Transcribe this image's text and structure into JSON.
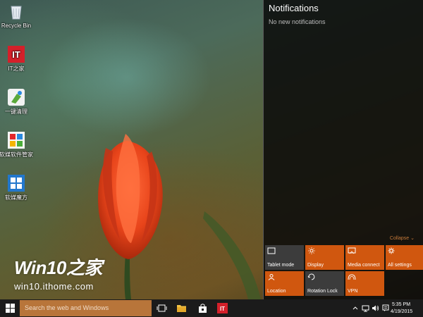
{
  "desktop": {
    "icons": [
      {
        "label": "Recycle Bin"
      },
      {
        "label": "IT之家"
      },
      {
        "label": "一键清理"
      },
      {
        "label": "软媒软件管家"
      },
      {
        "label": "软媒魔方"
      }
    ],
    "watermark": {
      "title": "Win10之家",
      "url": "win10.ithome.com"
    }
  },
  "action_center": {
    "title": "Notifications",
    "empty_text": "No new notifications",
    "collapse_label": "Collapse",
    "tiles": [
      {
        "label": "Tablet mode",
        "icon": "tablet-icon",
        "active": false
      },
      {
        "label": "Display",
        "icon": "brightness-icon",
        "active": true
      },
      {
        "label": "Media connect",
        "icon": "project-icon",
        "active": true
      },
      {
        "label": "All settings",
        "icon": "gear-icon",
        "active": true
      },
      {
        "label": "Location",
        "icon": "location-icon",
        "active": true
      },
      {
        "label": "Rotation Lock",
        "icon": "rotation-icon",
        "active": false
      },
      {
        "label": "VPN",
        "icon": "vpn-icon",
        "active": true
      }
    ]
  },
  "taskbar": {
    "search_placeholder": "Search the web and Windows",
    "clock": {
      "time": "5:35 PM",
      "date": "4/19/2015"
    },
    "accent_color": "#d0570f"
  }
}
